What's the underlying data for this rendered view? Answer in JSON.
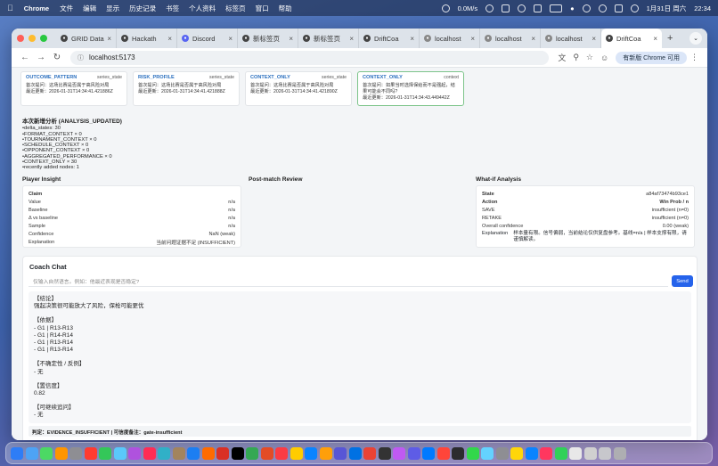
{
  "menubar": {
    "app": "Chrome",
    "items": [
      "文件",
      "编辑",
      "显示",
      "历史记录",
      "书签",
      "个人资料",
      "标签页",
      "窗口",
      "帮助"
    ],
    "net": "0.0M/s",
    "date": "1月31日 周六",
    "time": "22:34"
  },
  "tabs": [
    {
      "label": "GRID Data",
      "icon": "github-icon"
    },
    {
      "label": "Hackath",
      "icon": "github-icon"
    },
    {
      "label": "Discord",
      "icon": "discord-icon"
    },
    {
      "label": "新标签页",
      "icon": "github-icon"
    },
    {
      "label": "新标签页",
      "icon": "github-icon"
    },
    {
      "label": "DriftCoa",
      "icon": "github-icon"
    },
    {
      "label": "localhost",
      "icon": "globe-icon"
    },
    {
      "label": "localhost",
      "icon": "globe-icon"
    },
    {
      "label": "localhost",
      "icon": "globe-icon"
    },
    {
      "label": "DriftCoa",
      "icon": "github-icon"
    }
  ],
  "toolbar": {
    "url": "localhost:5173",
    "update_label": "有新版 Chrome 可用"
  },
  "cards": [
    {
      "title": "OUTCOME_PATTERN",
      "tag": "series_state",
      "line1": "首次提问：这场比赛是否属于高风险对局",
      "line2": "最近更新：2026-01-31T14:34:41.421886Z"
    },
    {
      "title": "RISK_PROFILE",
      "tag": "series_state",
      "line1": "首次提问：这场比赛是否属于高风险对局",
      "line2": "最近更新：2026-01-31T14:34:41.421888Z"
    },
    {
      "title": "CONTEXT_ONLY",
      "tag": "series_state",
      "line1": "首次提问：这场比赛是否属于高风险对局",
      "line2": "最近更新：2026-01-31T14:34:41.421890Z"
    },
    {
      "title": "CONTEXT_ONLY",
      "tag": "context",
      "line1": "首次提问：如果当时选择保给而不是强起，结果可能会不同吗?",
      "line2": "最近更新：2026-01-31T14:34:43.449442Z"
    }
  ],
  "analysis": {
    "heading": "本次新增分析 (ANALYSIS_UPDATED)",
    "items": [
      "delta_states: 30",
      "FORMAT_CONTEXT × 0",
      "TOURNAMENT_CONTEXT × 0",
      "SCHEDULE_CONTEXT × 0",
      "OPPONENT_CONTEXT × 0",
      "AGGREGATED_PERFORMANCE × 0",
      "CONTEXT_ONLY × 30",
      "recently added nodes: 1"
    ]
  },
  "sections": {
    "player": "Player Insight",
    "post": "Post-match Review",
    "whatif": "What-if Analysis"
  },
  "player": {
    "rows": [
      {
        "k": "Claim",
        "v": ""
      },
      {
        "k": "Value",
        "v": "n/a"
      },
      {
        "k": "Baseline",
        "v": "n/a"
      },
      {
        "k": "Δ vs baseline",
        "v": "n/a"
      },
      {
        "k": "Sample",
        "v": "n/a"
      },
      {
        "k": "Confidence",
        "v": "NaN (weak)"
      },
      {
        "k": "Explanation",
        "v": "当前问题证据不足 (INSUFFICIENT)"
      }
    ]
  },
  "whatif": {
    "rows": [
      {
        "k": "State",
        "v": "a84af73474b93ce1"
      },
      {
        "k": "Action",
        "v": "Win Prob / n"
      },
      {
        "k": "SAVE",
        "v": "insufficient (n=0)"
      },
      {
        "k": "RETAKE",
        "v": "insufficient (n=0)"
      },
      {
        "k": "Overall confidence",
        "v": "0.00 (weak)"
      }
    ],
    "expl_k": "Explanation",
    "expl_v": "样本量有限。信号偏弱，当前结论仅供复盘参考。基线=n/a | 样本支撑有限，请谨慎解读。"
  },
  "chat": {
    "title": "Coach Chat",
    "placeholder": "仅输入自然语言。例如：他最近表现是否稳定?",
    "send": "Send",
    "lines": [
      "【结论】",
      "强起决策很可能放大了风险，保枪可能更优",
      "",
      "【依据】",
      "- G1 | R13-R13",
      "- G1 | R14-R14",
      "- G1 | R13-R14",
      "- G1 | R13-R14",
      "",
      "【不确定性 / 反例】",
      "- 无",
      "",
      "【置信度】",
      "0.82",
      "",
      "【可继续追问】",
      "- 无"
    ],
    "verdict": "判定：EVIDENCE_INSUFFICIENT | 可信度备注：gate-insufficient"
  },
  "dock_colors": [
    "#2e7df6",
    "#4da3f5",
    "#4cd964",
    "#ff9500",
    "#8e8e93",
    "#ff3b30",
    "#34c759",
    "#5ac8fa",
    "#af52de",
    "#ff2d55",
    "#30b0c7",
    "#a2845e",
    "#1c7ef2",
    "#ff6b00",
    "#d93025",
    "#000000",
    "#34a853",
    "#e34c26",
    "#fc3c44",
    "#ffcc00",
    "#0a84ff",
    "#ff9f0a",
    "#5856d6",
    "#0071e3",
    "#ea4335",
    "#333333",
    "#bf5af2",
    "#5e5ce6",
    "#007aff",
    "#ff453a",
    "#2c2c2e",
    "#32d74b",
    "#64d2ff",
    "#8e8e93",
    "#ffd60a",
    "#0a84ff",
    "#ff375f",
    "#30d158",
    "#e8e8e8",
    "#d0d0d0",
    "#c7c7cc",
    "#aeaeb2"
  ]
}
